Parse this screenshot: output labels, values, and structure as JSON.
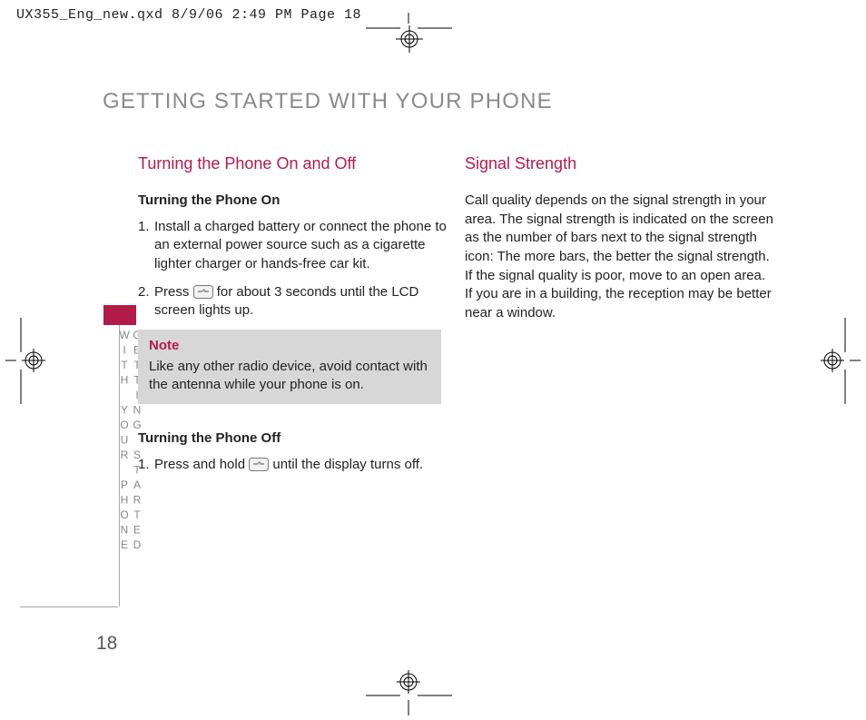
{
  "slug": "UX355_Eng_new.qxd  8/9/06  2:49 PM  Page 18",
  "title": "GETTING STARTED WITH YOUR PHONE",
  "sidetext": "GETTING STARTED WITH YOUR PHONE",
  "pagenum": "18",
  "left": {
    "h": "Turning the Phone On and Off",
    "s1": "Turning the Phone On",
    "i1n": "1.",
    "i1": "Install a charged battery or connect the phone to an external power source such as a cigarette lighter charger or hands-free car kit.",
    "i2n": "2.",
    "i2a": "Press ",
    "i2b": " for about 3 seconds until the LCD screen lights up.",
    "note_h": "Note",
    "note_t": "Like any other radio device, avoid contact with the antenna while your phone is on.",
    "s2": "Turning the Phone Off",
    "o1n": "1.",
    "o1a": "Press and hold ",
    "o1b": " until the display turns off."
  },
  "right": {
    "h": "Signal Strength",
    "p": "Call quality depends on the signal strength in your area. The signal strength is indicated on the screen as the number of bars next to the signal strength icon: The more bars, the better the signal strength. If the signal quality is poor, move to an open area. If you are in a building, the reception may be better near a window."
  }
}
